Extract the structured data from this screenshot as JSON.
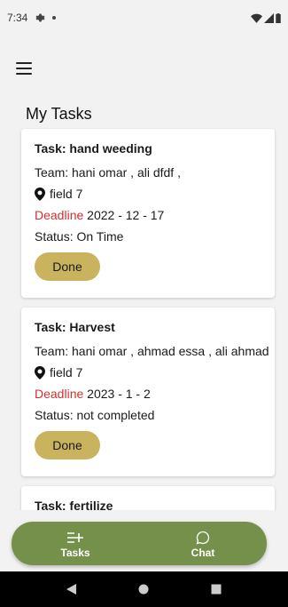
{
  "status_bar": {
    "time": "7:34"
  },
  "header": {
    "title": "My Tasks"
  },
  "tasks": [
    {
      "title": "Task: hand weeding",
      "team_label": "Team:",
      "team": "hani omar , ali dfdf ,",
      "location": "field 7",
      "deadline_label": "Deadline",
      "deadline": "2022 - 12 - 17",
      "status_label": "Status:",
      "status": "On Time",
      "button": "Done"
    },
    {
      "title": "Task: Harvest",
      "team_label": "Team:",
      "team": "hani omar , ahmad essa  , ali ahmad",
      "location": "field 7",
      "deadline_label": "Deadline",
      "deadline": "2023 - 1 - 2",
      "status_label": "Status:",
      "status": "not completed",
      "button": "Done"
    },
    {
      "title": "Task: fertilize"
    }
  ],
  "bottom_nav": {
    "items": [
      {
        "label": "Tasks",
        "icon": "tasks-add-icon"
      },
      {
        "label": "Chat",
        "icon": "chat-bubble-icon"
      }
    ]
  },
  "colors": {
    "accent": "#75904a",
    "button": "#c9b35f",
    "deadline": "#d32f2f"
  }
}
